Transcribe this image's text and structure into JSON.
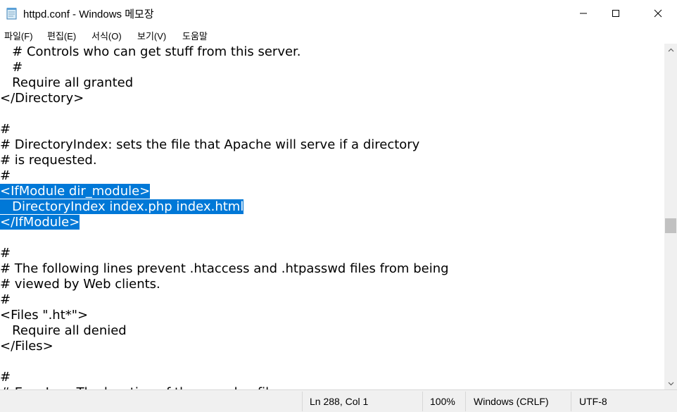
{
  "window": {
    "title": "httpd.conf - Windows 메모장"
  },
  "menu": {
    "items": [
      {
        "label": "파일(F)"
      },
      {
        "label": "편집(E)"
      },
      {
        "label": "서식(O)"
      },
      {
        "label": "보기(V)"
      },
      {
        "label": "도움말"
      }
    ]
  },
  "editor": {
    "lines": [
      "   # Controls who can get stuff from this server.",
      "   #",
      "   Require all granted",
      "</Directory>",
      "",
      "#",
      "# DirectoryIndex: sets the file that Apache will serve if a directory",
      "# is requested.",
      "#",
      "<IfModule dir_module>",
      "   DirectoryIndex index.php index.html",
      "</IfModule>",
      "",
      "#",
      "# The following lines prevent .htaccess and .htpasswd files from being",
      "# viewed by Web clients.",
      "#",
      "<Files \".ht*\">",
      "   Require all denied",
      "</Files>",
      "",
      "#",
      "# ErrorLog: The location of the error log file."
    ],
    "selected_lines": [
      9,
      10,
      11
    ],
    "selection_color": "#0078d7"
  },
  "status": {
    "position": "Ln 288, Col 1",
    "zoom": "100%",
    "line_ending": "Windows (CRLF)",
    "encoding": "UTF-8"
  }
}
